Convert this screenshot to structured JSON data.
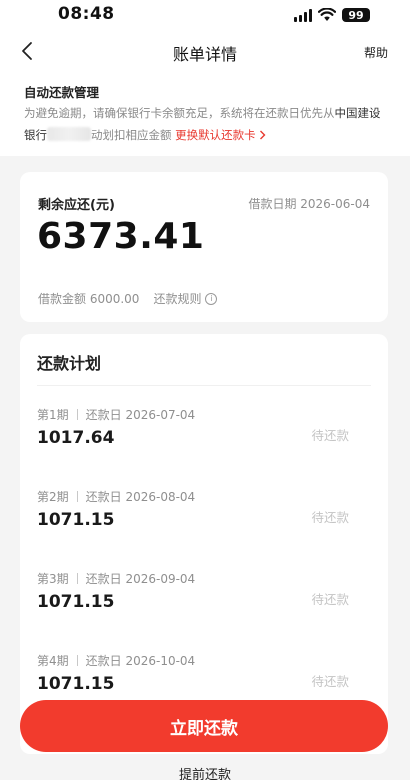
{
  "status_bar": {
    "time": "08:48",
    "battery": "99"
  },
  "nav": {
    "title": "账单详情",
    "help": "帮助"
  },
  "autopay": {
    "title": "自动还款管理",
    "desc_before": "为避免逾期，请确保银行卡余额充足，系统将在还款日优先从",
    "bank_part1": "中国建设银行",
    "desc_after": "动划扣相应金额",
    "change_card": "更换默认还款卡"
  },
  "summary": {
    "remain_label": "剩余应还(元)",
    "loan_date": "借款日期 2026-06-04",
    "remain_amount": "6373.41",
    "loan_amount": "借款金额 6000.00",
    "rules": "还款规则"
  },
  "plan": {
    "title": "还款计划",
    "rows": [
      {
        "period": "第1期",
        "due": "还款日 2026-07-04",
        "amount": "1017.64",
        "status": "待还款"
      },
      {
        "period": "第2期",
        "due": "还款日 2026-08-04",
        "amount": "1071.15",
        "status": "待还款"
      },
      {
        "period": "第3期",
        "due": "还款日 2026-09-04",
        "amount": "1071.15",
        "status": "待还款"
      },
      {
        "period": "第4期",
        "due": "还款日 2026-10-04",
        "amount": "1071.15",
        "status": "待还款"
      }
    ]
  },
  "actions": {
    "pay_now": "立即还款",
    "early_repay": "提前还款"
  },
  "colors": {
    "accent": "#f23b2d",
    "link": "#e8382f",
    "muted": "#8f8f8f",
    "background": "#f4f4f4"
  }
}
